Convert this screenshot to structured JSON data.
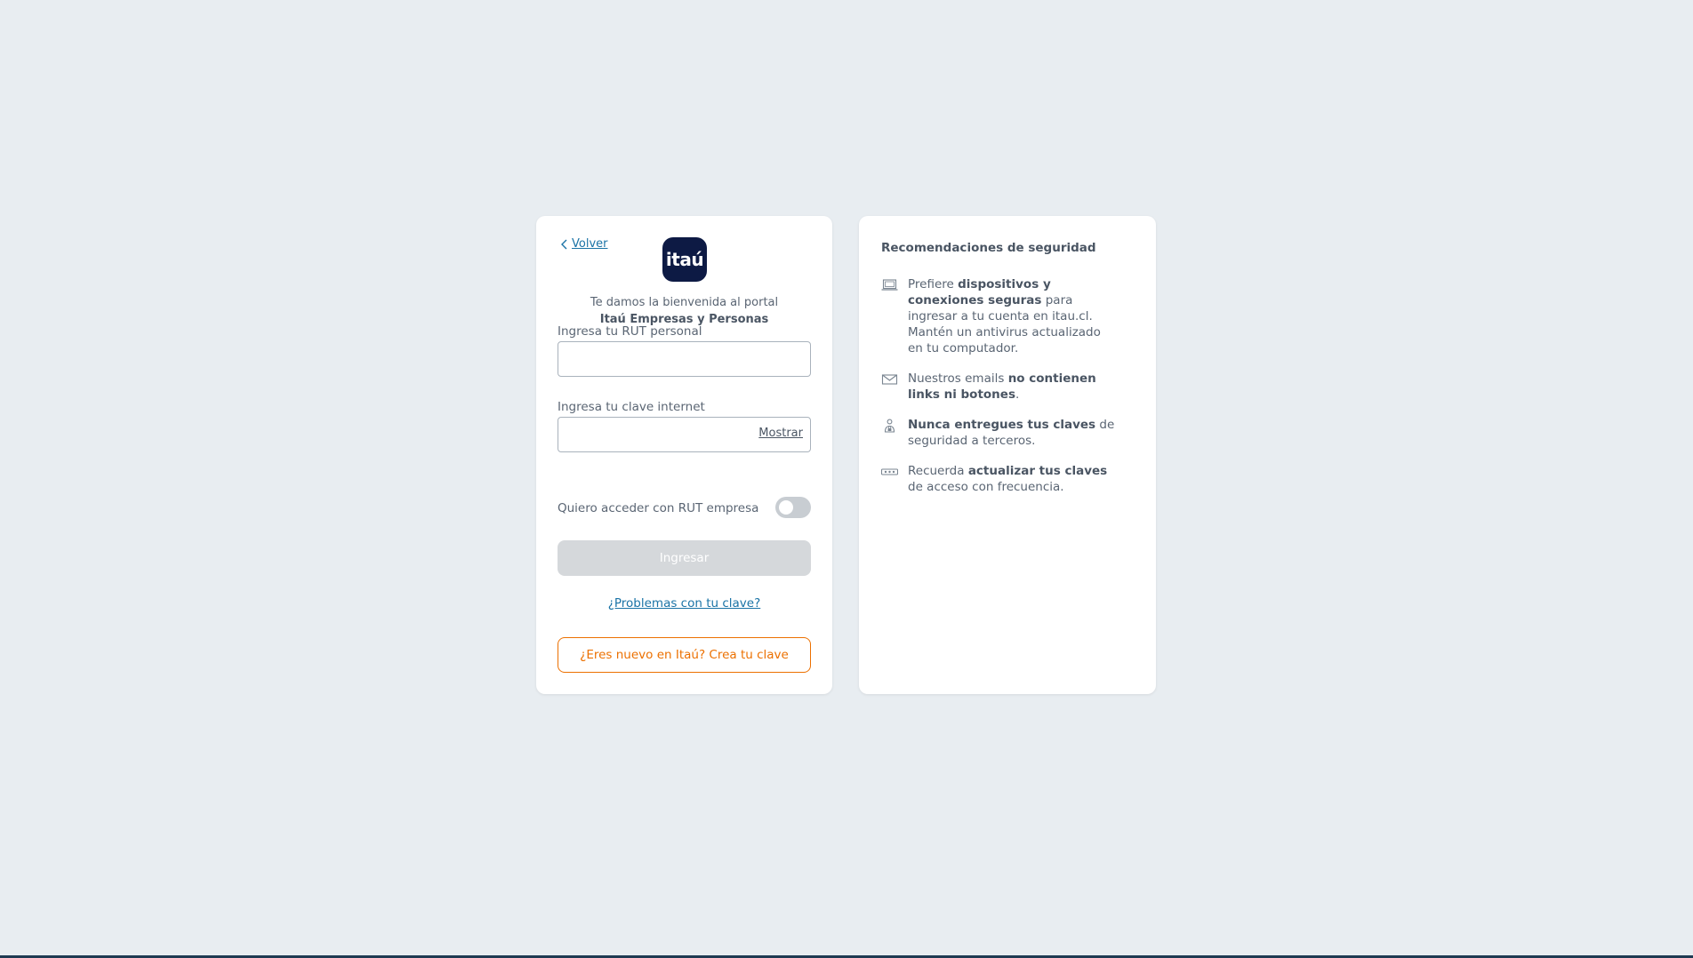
{
  "login": {
    "back_label": "Volver",
    "logo_text": "itaú",
    "welcome_line1": "Te damos la bienvenida al portal",
    "welcome_line2": "Itaú Empresas y Personas",
    "rut_label": "Ingresa tu RUT personal",
    "rut_value": "",
    "password_label": "Ingresa tu clave internet",
    "password_value": "",
    "show_label": "Mostrar",
    "company_toggle_label": "Quiero acceder con RUT empresa",
    "company_toggle_on": false,
    "submit_label": "Ingresar",
    "problems_link": "¿Problemas con tu clave?",
    "new_user_label": "¿Eres nuevo en Itaú? Crea tu clave"
  },
  "security": {
    "title": "Recomendaciones de seguridad",
    "tips": [
      {
        "icon": "laptop-icon",
        "parts": [
          "Prefiere ",
          "dispositivos y conexiones seguras",
          " para ingresar a tu cuenta en itau.cl. Mantén un antivirus actualizado en tu computador."
        ]
      },
      {
        "icon": "mail-icon",
        "parts": [
          "Nuestros emails ",
          "no contienen links ni botones",
          "."
        ]
      },
      {
        "icon": "person-lock-icon",
        "parts": [
          "",
          "Nunca entregues tus claves",
          " de seguridad a terceros."
        ]
      },
      {
        "icon": "password-icon",
        "parts": [
          "Recuerda ",
          "actualizar tus claves",
          " de acceso con frecuencia."
        ]
      }
    ]
  },
  "colors": {
    "background": "#e8edf1",
    "brand_navy": "#0d1a44",
    "link_blue": "#1a73a6",
    "accent_orange": "#ec7000",
    "disabled_button": "#d5d8db"
  }
}
